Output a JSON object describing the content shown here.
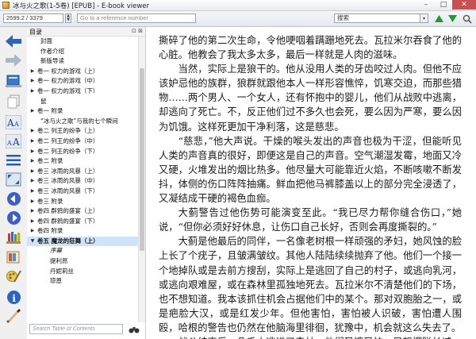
{
  "window": {
    "title": "冰与火之歌(1-5卷) [EPUB] - E-book viewer",
    "minimize": "–",
    "maximize": "□",
    "close": "✕"
  },
  "toolbar": {
    "position_value": "2599.2 / 3379",
    "reference_placeholder": "Go to a reference number",
    "search_value": "搜索",
    "search_dropdown": "▾"
  },
  "toc": {
    "header_label": "目录",
    "header_buttons": "⊡ ⊠",
    "search_placeholder": "Search Table of Contents",
    "items": [
      {
        "exp": "",
        "indent": 1,
        "text": "封面"
      },
      {
        "exp": "",
        "indent": 1,
        "text": "作者介绍"
      },
      {
        "exp": "",
        "indent": 1,
        "text": "新版导读"
      },
      {
        "exp": "▶",
        "indent": 0,
        "text": "卷一 权力的游戏（上）"
      },
      {
        "exp": "▶",
        "indent": 0,
        "text": "卷一 权力的游戏（中）"
      },
      {
        "exp": "▶",
        "indent": 0,
        "text": "卷一 权力的游戏（下）"
      },
      {
        "exp": "",
        "indent": 1,
        "text": "鼠"
      },
      {
        "exp": "▶",
        "indent": 0,
        "text": "卷一 附录"
      },
      {
        "exp": "",
        "indent": 1,
        "text": "“冰与火之歌”与我的七个瞬间"
      },
      {
        "exp": "▶",
        "indent": 0,
        "text": "卷二 列王的纷争（上）"
      },
      {
        "exp": "▶",
        "indent": 0,
        "text": "卷二 列王的纷争（中）"
      },
      {
        "exp": "▶",
        "indent": 0,
        "text": "卷二 列王的纷争（下）"
      },
      {
        "exp": "▶",
        "indent": 0,
        "text": "卷二 附录"
      },
      {
        "exp": "▶",
        "indent": 0,
        "text": "卷三 冰雨的风暴（上）"
      },
      {
        "exp": "▶",
        "indent": 0,
        "text": "卷三 冰雨的风暴（中）"
      },
      {
        "exp": "▶",
        "indent": 0,
        "text": "卷三 冰雨的风暴（下）"
      },
      {
        "exp": "▶",
        "indent": 0,
        "text": "卷三 附录"
      },
      {
        "exp": "▶",
        "indent": 0,
        "text": "卷四 群鸦的盛宴（上）"
      },
      {
        "exp": "▶",
        "indent": 0,
        "text": "卷四 群鸦的盛宴（下）"
      },
      {
        "exp": "▶",
        "indent": 0,
        "text": "卷四 附录"
      },
      {
        "exp": "▼",
        "indent": 0,
        "text": "卷五 魔龙的狂舞（上）",
        "selected": true
      },
      {
        "exp": "",
        "indent": 2,
        "text": "序幕",
        "child": true
      },
      {
        "exp": "",
        "indent": 2,
        "text": "提利昂"
      },
      {
        "exp": "",
        "indent": 2,
        "text": "丹妮莉丝"
      },
      {
        "exp": "",
        "indent": 2,
        "text": "琼恩"
      }
    ]
  },
  "reader": {
    "paragraphs": [
      {
        "text": "撕碎了他的第二次生命，令他哽咽着蹒跚地死去。瓦拉米尔吞食了他的心脏。他教会了我太多太多，最后一样就是人肉的滋味。",
        "noindent": true
      },
      {
        "text": "当然，实际上是狼干的。他从没用人类的牙齿咬过人肉。但他不应该妒忌他的族群，狼群就跟他本人一样形容憔悴，饥寒交迫，而那些猎物……两个男人、一个女人，还有怀抱中的婴儿，他们从战败中逃离，却逃向了死亡。不，反正他们过不多久也会死，要么因为严寒，要么因为饥饿。这样死更加干净利落，这是慈悲。"
      },
      {
        "text": "“慈悲，”他大声说。干燥的喉头发出的声音也极为干涩，但能听见人类的声音真的很好，即便这是自己的声音。空气潮湿发霉，地面又冷又硬，火堆发出的烟比热多。他尽量大可能靠近火焰，不断咳嗽不断发抖，体侧的伤口阵阵抽痛。鲜血把他马裤膝盖以上的部分完全浸透了，又凝结成干硬的褐色血痂。"
      },
      {
        "text": "大蓟警告过他伤势可能演变至此。“我已尽力帮你缝合伤口，”她说，“但你必须好好休息，让伤口自己长好，否则会再度撕裂的。”"
      },
      {
        "text": "大蓟是他最后的同伴，一名像老树根一样顽强的矛妇，她风蚀的脸上长了个疣子，且皱满皱纹。其他人陆陆续续抛弃了他。他们一个接一个地掉队或是去前方搜刮，实际上是逃回了自己的村子，或逃向乳河，或逃向艰难屋，或在森林里孤独地死去。瓦拉米尔不清楚他们的下场，也不想知道。我本该抓住机会占据他们中的某个。那对双胞胎之一，或是疤脸大汉，或是红发少年。但他害怕，害怕被人识破，害怕遭人围殴，哈根的警告也仍然在他脑海里徘徊，犹豫中，机会就这么失去了。"
      },
      {
        "text": "战斗结束后，几千人逃进了森林，他们又饿又怕，只想摆脱长城"
      }
    ]
  }
}
